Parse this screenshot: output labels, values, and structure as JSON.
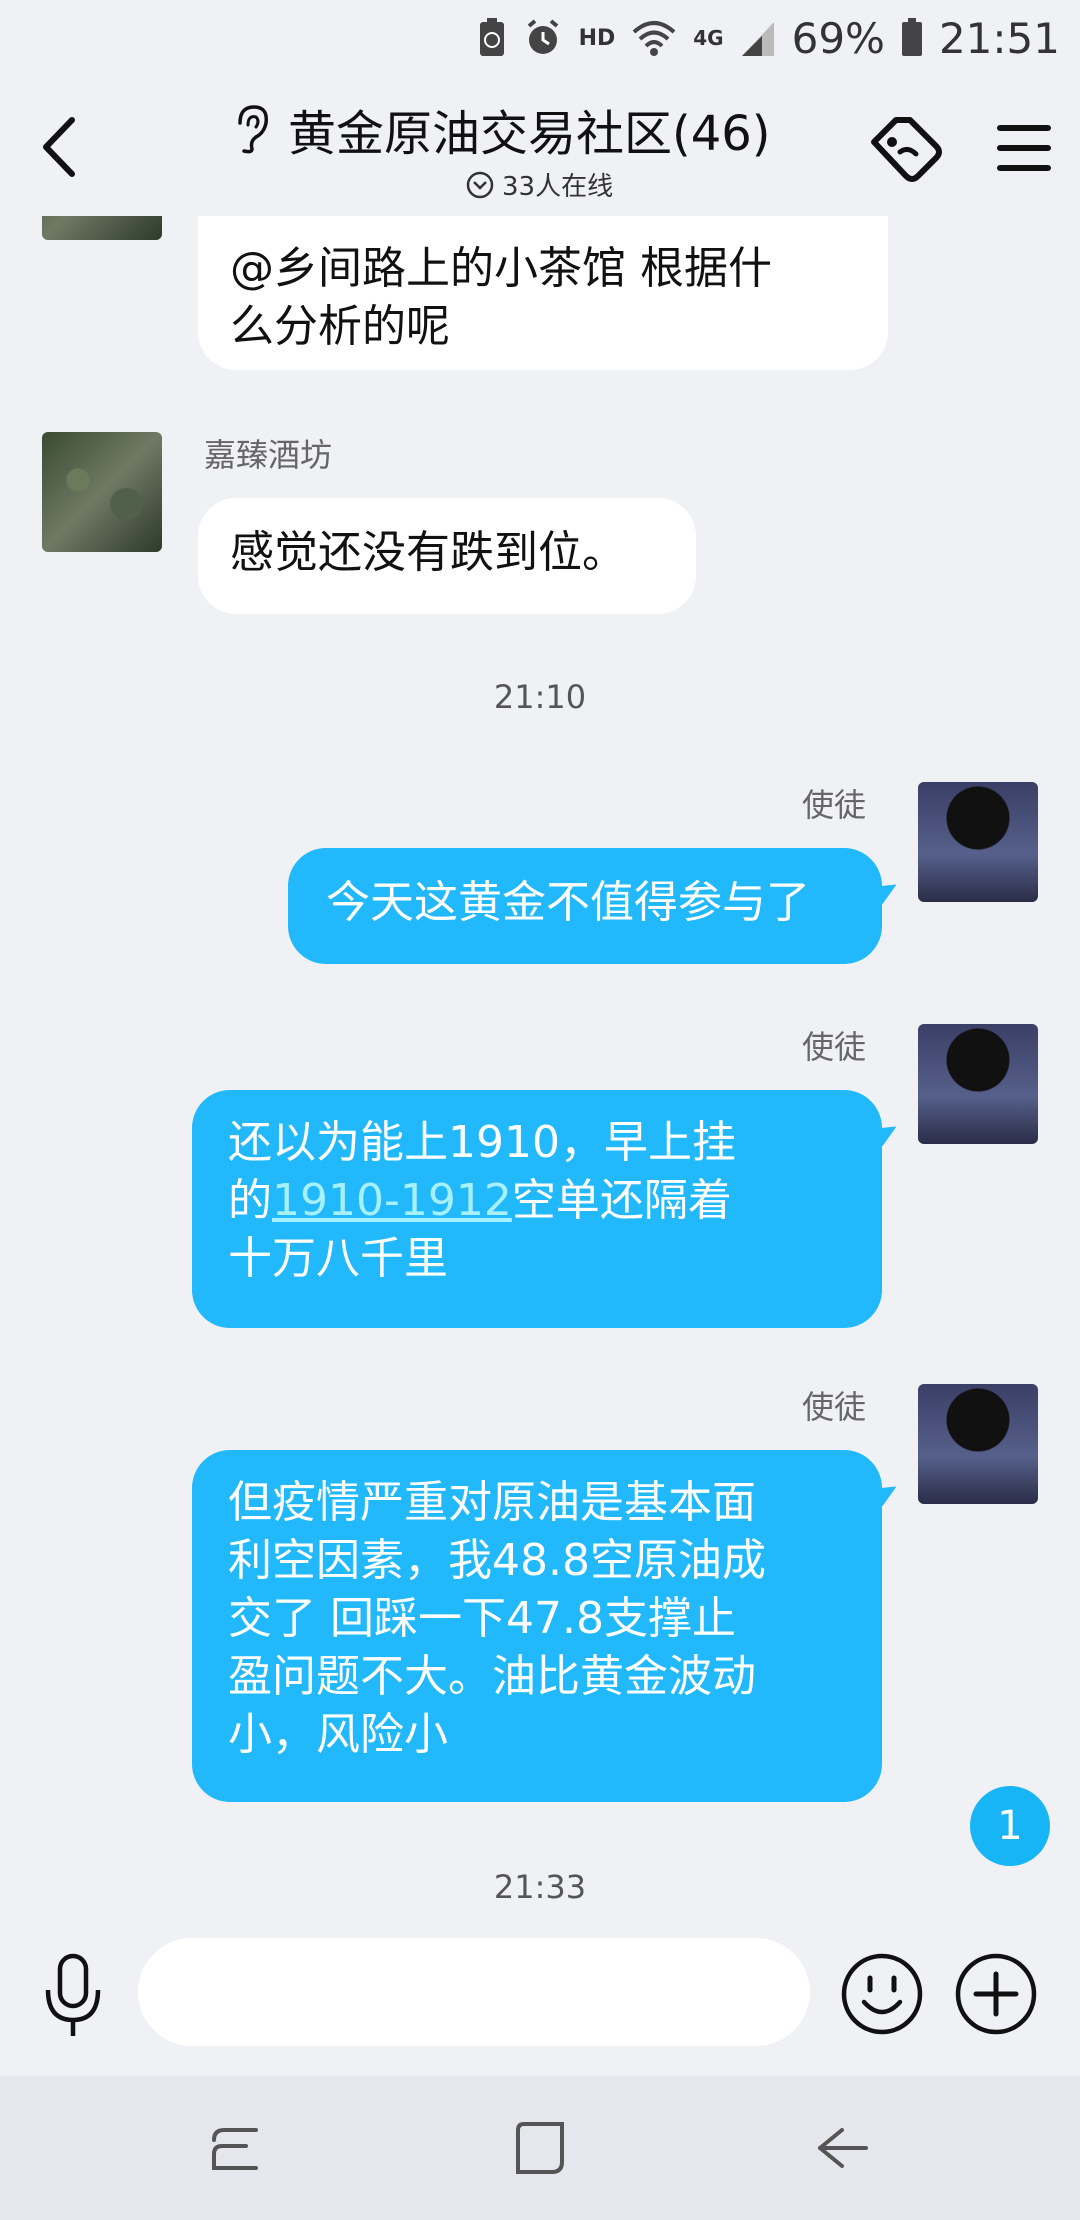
{
  "status_bar": {
    "battery": "69%",
    "time": "21:51",
    "hd_label": "HD",
    "net_label": "4G"
  },
  "header": {
    "title": "黄金原油交易社区(46)",
    "online": "33人在线"
  },
  "messages": [
    {
      "type": "incoming",
      "text_lines": [
        "@乡间路上的小茶馆 根据什",
        "么分析的呢"
      ]
    },
    {
      "type": "incoming",
      "sender": "嘉臻酒坊",
      "text": "感觉还没有跌到位。"
    },
    {
      "type": "timestamp",
      "text": "21:10"
    },
    {
      "type": "outgoing",
      "sender": "使徒",
      "text": "今天这黄金不值得参与了"
    },
    {
      "type": "outgoing",
      "sender": "使徒",
      "line1": "还以为能上1910，早上挂",
      "line2_prefix": "的",
      "line2_link": "1910-1912",
      "line2_suffix": "空单还隔着",
      "line3": "十万八千里"
    },
    {
      "type": "outgoing",
      "sender": "使徒",
      "text_lines": [
        "但疫情严重对原油是基本面",
        "利空因素，我48.8空原油成",
        "交了  回踩一下47.8支撑止",
        "盈问题不大。油比黄金波动",
        "小，风险小"
      ]
    },
    {
      "type": "timestamp",
      "text": "21:33"
    }
  ],
  "unread_badge": "1",
  "input": {
    "placeholder": ""
  },
  "colors": {
    "outgoing_bubble": "#21b9fb",
    "incoming_bubble": "#ffffff",
    "background": "#f0f1f5",
    "link": "#a6f0ff"
  },
  "icons": {
    "back": "chevron-left-icon",
    "ear": "ear-icon",
    "tag": "tag-icon",
    "menu": "menu-icon",
    "voice": "microphone-icon",
    "emoji": "emoji-icon",
    "add": "plus-circle-icon"
  }
}
